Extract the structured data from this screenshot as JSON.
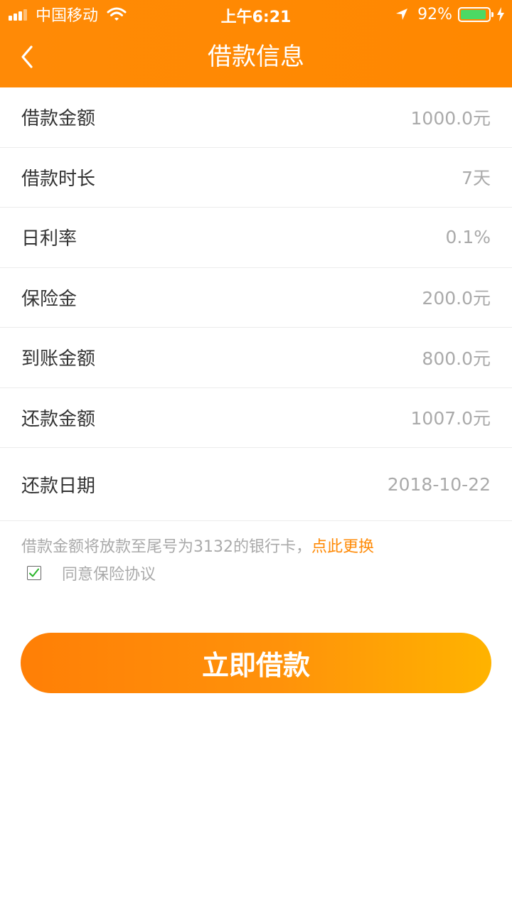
{
  "status_bar": {
    "carrier": "中国移动",
    "time": "上午6:21",
    "battery_percent": "92%",
    "battery_level": 0.92,
    "battery_color": "#4cd964"
  },
  "nav": {
    "title": "借款信息",
    "back_icon": "chevron-left-icon"
  },
  "loan_info": [
    {
      "label": "借款金额",
      "value": "1000.0元"
    },
    {
      "label": "借款时长",
      "value": "7天"
    },
    {
      "label": "日利率",
      "value": "0.1%"
    },
    {
      "label": "保险金",
      "value": "200.0元"
    },
    {
      "label": "到账金额",
      "value": "800.0元"
    },
    {
      "label": "还款金额",
      "value": "1007.0元"
    },
    {
      "label": "还款日期",
      "value": "2018-10-22"
    }
  ],
  "notice": {
    "text": "借款金额将放款至尾号为3132的银行卡，",
    "link": "点此更换"
  },
  "agreement": {
    "checked": true,
    "label": "同意保险协议"
  },
  "submit_label": "立即借款",
  "colors": {
    "accent": "#ff8a06",
    "accent_end": "#ffb300",
    "label": "#333333",
    "value": "#aaaaaa",
    "check": "#2bb52b"
  }
}
